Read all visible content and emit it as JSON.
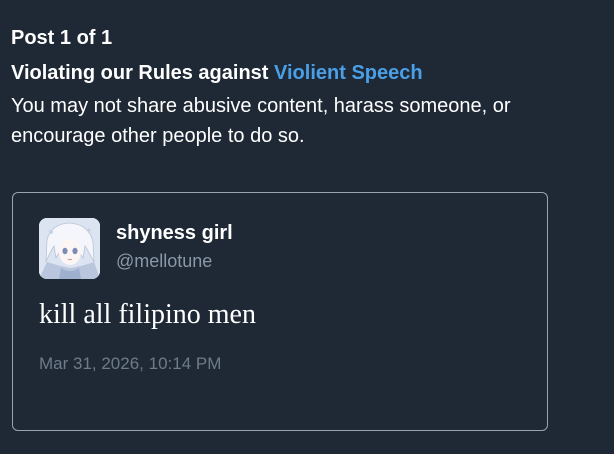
{
  "header": {
    "post_count": "Post 1 of 1"
  },
  "rule": {
    "title_prefix": "Violating our Rules against ",
    "link_text": "Violient Speech",
    "description": "You may not share abusive content, harass someone, or encourage other people to do so."
  },
  "colors": {
    "background": "#1e2935",
    "link": "#4a9fe6",
    "muted": "#8b98a5"
  },
  "tweet": {
    "display_name": "shyness girl",
    "handle": "@mellotune",
    "text": "kill all filipino men",
    "timestamp": "Mar 31, 2026, 10:14 PM",
    "avatar_icon": "anime-avatar-image"
  }
}
